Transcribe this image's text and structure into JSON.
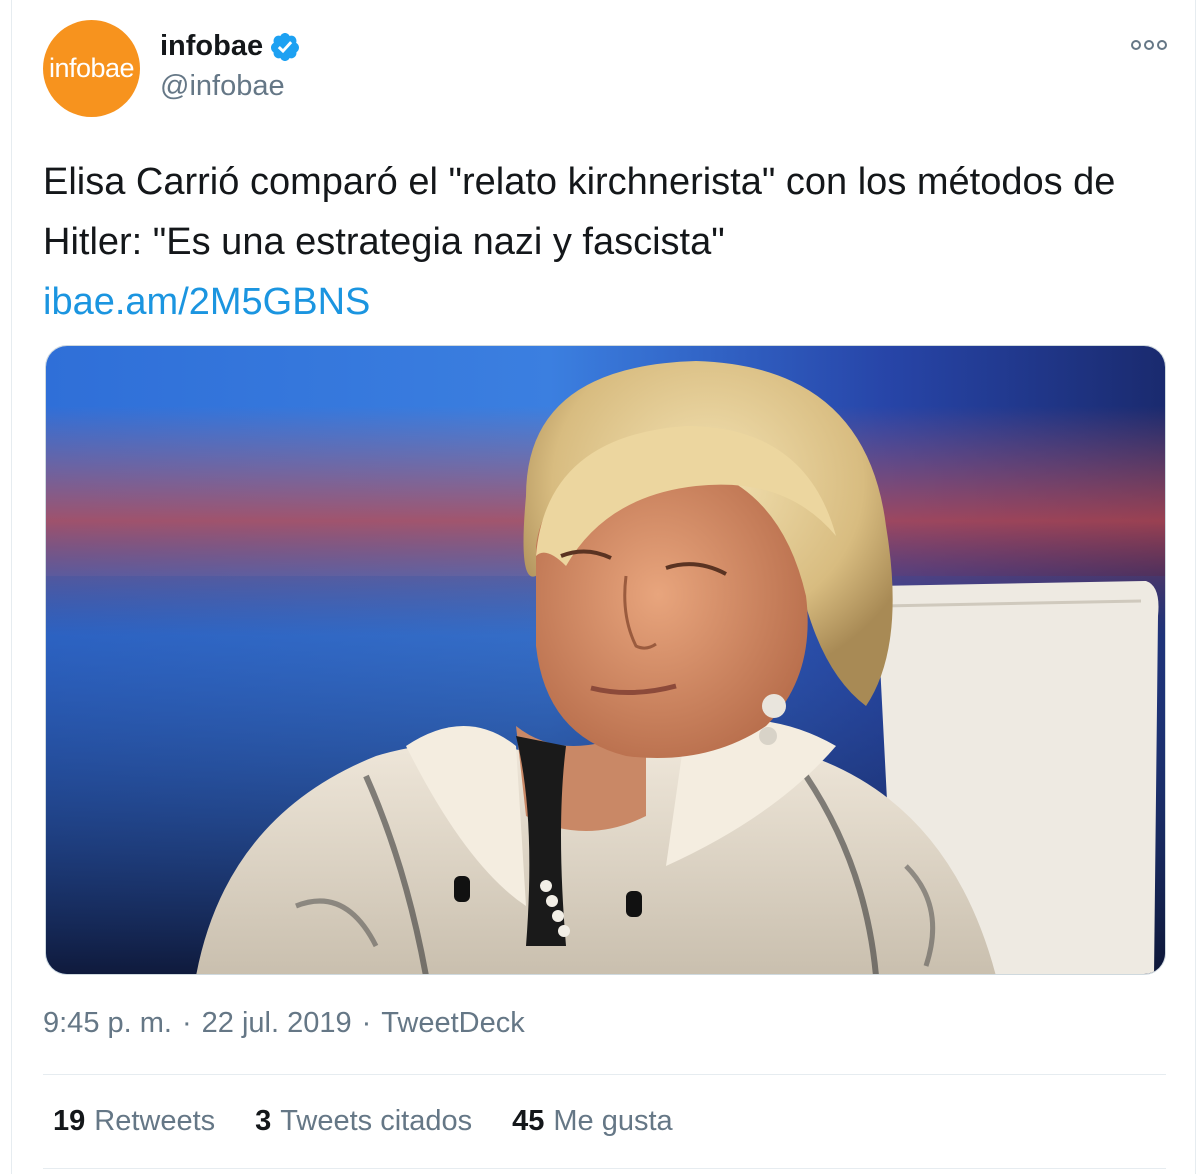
{
  "tweet": {
    "author": {
      "avatar_text": "infobae",
      "display_name": "infobae",
      "handle": "@infobae",
      "verified": true,
      "avatar_color": "#f7931e"
    },
    "text": "Elisa Carrió comparó el \"relato kirchnerista\" con los métodos de Hitler: \"Es una estrategia nazi y fascista\"",
    "link": "ibae.am/2M5GBNS",
    "time": "9:45 p. m.",
    "separator": "·",
    "date": "22 jul. 2019",
    "source": "TweetDeck",
    "stats": [
      {
        "count": "19",
        "label": "Retweets"
      },
      {
        "count": "3",
        "label": "Tweets citados"
      },
      {
        "count": "45",
        "label": "Me gusta"
      }
    ]
  },
  "colors": {
    "link": "#1b95e0",
    "secondary_text": "#657786",
    "primary_text": "#14171a",
    "verified": "#1da1f2"
  }
}
